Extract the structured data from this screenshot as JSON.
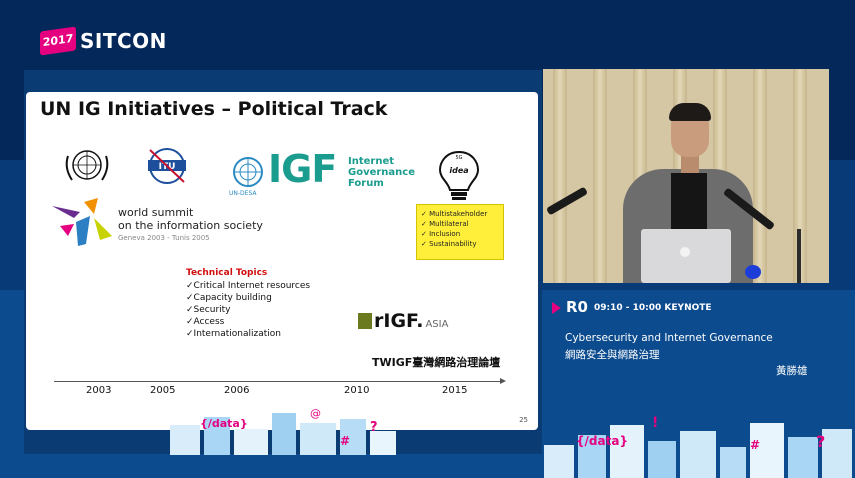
{
  "event": {
    "logo_year": "2017",
    "logo_name": "SITCON",
    "brand_color": "#e4007f"
  },
  "slide": {
    "title": "UN IG Initiatives – Political Track",
    "igf_logo": {
      "mark": "IGF",
      "line1": "Internet",
      "line2": "Governance",
      "line3": "Forum",
      "undesa_label": "UN-DESA"
    },
    "wsis": {
      "line1": "world summit",
      "line2": "on the information society",
      "line3": "Geneva 2003 - Tunis 2005"
    },
    "idea_box": {
      "bulb_label_top": "5G",
      "bulb_label": "idea",
      "items": [
        "✓ Multistakeholder",
        "✓ Multilateral",
        "✓ Inclusion",
        "✓ Sustainability"
      ]
    },
    "technical_topics": {
      "heading": "Technical Topics",
      "items": [
        "✓Critical Internet resources",
        "✓Capacity building",
        "✓Security",
        "✓Access",
        "✓Internationalization"
      ]
    },
    "rigf": {
      "mark": "rIGF.",
      "suffix": "ASIA"
    },
    "twigf": "TWIGF臺灣網路治理論壇",
    "timeline_years": [
      "2003",
      "2005",
      "2006",
      "2010",
      "2015"
    ],
    "page_number": "25"
  },
  "session": {
    "room": "R0",
    "time": "09:10 - 10:00 KEYNOTE",
    "title_en": "Cybersecurity and Internet Governance",
    "title_zh": "網路安全與網路治理",
    "speaker": "黃勝雄"
  },
  "icons": {
    "play": "play-triangle-icon",
    "un": "un-emblem-icon",
    "itu": "itu-logo-icon",
    "bulb": "lightbulb-icon"
  }
}
